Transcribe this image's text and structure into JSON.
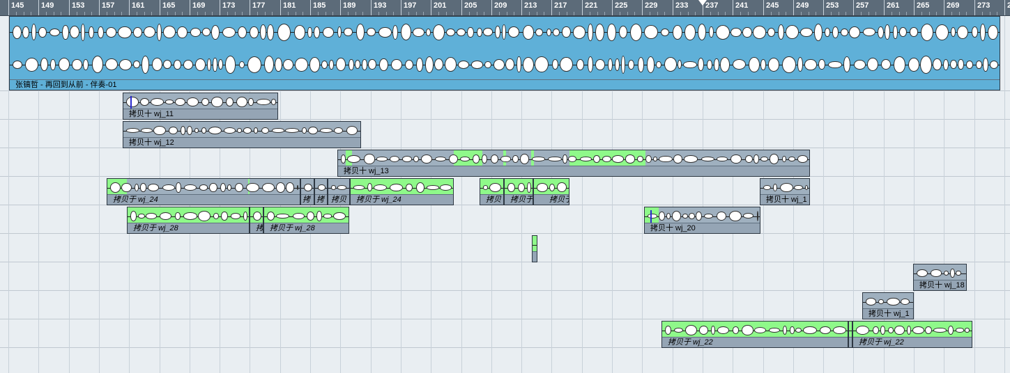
{
  "ruler": {
    "labels": [
      "145",
      "149",
      "153",
      "157",
      "161",
      "165",
      "169",
      "173",
      "177",
      "181",
      "185",
      "189",
      "193",
      "197",
      "201",
      "205",
      "209",
      "213",
      "217",
      "221",
      "225",
      "229",
      "233",
      "237",
      "241",
      "245",
      "249",
      "253",
      "257",
      "261",
      "265",
      "269",
      "273",
      "27"
    ],
    "playhead_bar": "237"
  },
  "main_track": {
    "label": "张镐哲 - 再回到从前 - 伴奏-01",
    "color": "#5fb0d8"
  },
  "events": {
    "wj11": "拷贝十 wj_11",
    "wj12": "拷贝十 wj_12",
    "wj13": "拷贝十 wj_13",
    "wj24a": "拷贝于 wj_24",
    "wj24b": "拷",
    "wj24c": "拷",
    "wj24d": "拷贝",
    "wj24e": "拷贝于 wj_24",
    "s1": "拷贝",
    "s2": "拷贝于",
    "s3": "拷贝于",
    "wj1a": "拷贝十 wj_1",
    "wj28a": "拷贝于 wj_28",
    "wj28b": "拷",
    "wj28c": "拷贝于 wj_28",
    "wj20": "拷贝十 wj_20",
    "wj18": "拷贝十 wj_18",
    "wj1b": "拷贝十 wj_1",
    "wj22a": "拷贝于 wj_22",
    "wj22b": "拷贝于 wj_22"
  },
  "colors": {
    "ruler_bg": "#5c6b79",
    "arrange_bg": "#e9eef2",
    "event_gray": "#9fb0bf",
    "event_selected": "#5fb0d8",
    "edited_green": "#8ff98a"
  }
}
